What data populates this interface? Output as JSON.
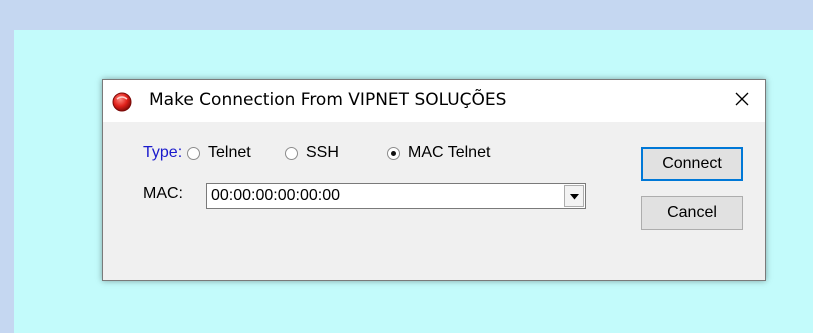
{
  "dialog": {
    "title": "Make Connection From VIPNET SOLUÇÕES",
    "icon": "red-circle-app-icon",
    "close_icon": "close-icon"
  },
  "form": {
    "type_label": "Type:",
    "type_options": [
      {
        "label": "Telnet",
        "selected": false
      },
      {
        "label": "SSH",
        "selected": false
      },
      {
        "label": "MAC Telnet",
        "selected": true
      }
    ],
    "mac_label": "MAC:",
    "mac_value": "00:00:00:00:00:00"
  },
  "buttons": {
    "connect": "Connect",
    "cancel": "Cancel"
  },
  "colors": {
    "background": "#c5d7f1",
    "workspace": "#c3fbfb",
    "type_label": "#1a1acc",
    "default_button_border": "#0078d7"
  }
}
